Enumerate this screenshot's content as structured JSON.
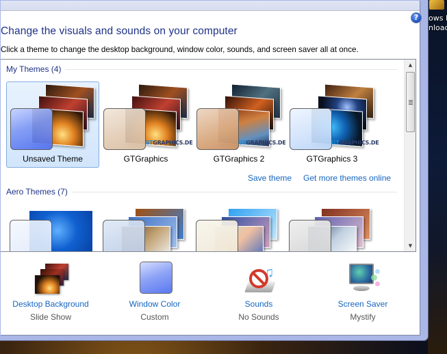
{
  "page": {
    "title": "Change the visuals and sounds on your computer",
    "description": "Click a theme to change the desktop background, window color, sounds, and screen saver all at once.",
    "help_icon": "help-icon"
  },
  "groups": [
    {
      "header": "My Themes (4)",
      "themes": [
        {
          "name": "Unsaved Theme",
          "selected": true,
          "swatch_color": "#5b7cf0",
          "watermark": false
        },
        {
          "name": "GTGraphics",
          "selected": false,
          "swatch_color": "#e4cdb4",
          "watermark": true
        },
        {
          "name": "GTGraphics 2",
          "selected": false,
          "swatch_color": "#d9a77a",
          "watermark": true
        },
        {
          "name": "GTGraphics 3",
          "selected": false,
          "swatch_color": "#cfe2fb",
          "watermark": true
        }
      ],
      "watermark_text_a": "GT",
      "watermark_text_b": "GRAPHICS.DE"
    },
    {
      "header": "Aero Themes (7)",
      "themes": [
        {
          "swatch_color": "#dde9f9"
        },
        {
          "swatch_color": "#b7c9e4"
        },
        {
          "swatch_color": "#efe7d6"
        },
        {
          "swatch_color": "#d9d9d9"
        }
      ]
    }
  ],
  "links": {
    "save_theme": "Save theme",
    "get_more": "Get more themes online"
  },
  "settings": [
    {
      "label": "Desktop Background",
      "value": "Slide Show"
    },
    {
      "label": "Window Color",
      "value": "Custom"
    },
    {
      "label": "Sounds",
      "value": "No Sounds"
    },
    {
      "label": "Screen Saver",
      "value": "Mystify"
    }
  ],
  "desktop": {
    "icon_text_line1": "ows I",
    "icon_text_line2": "nload"
  },
  "colors": {
    "title": "#1e3287",
    "link": "#1565c0",
    "selection_border": "#84acdd"
  }
}
